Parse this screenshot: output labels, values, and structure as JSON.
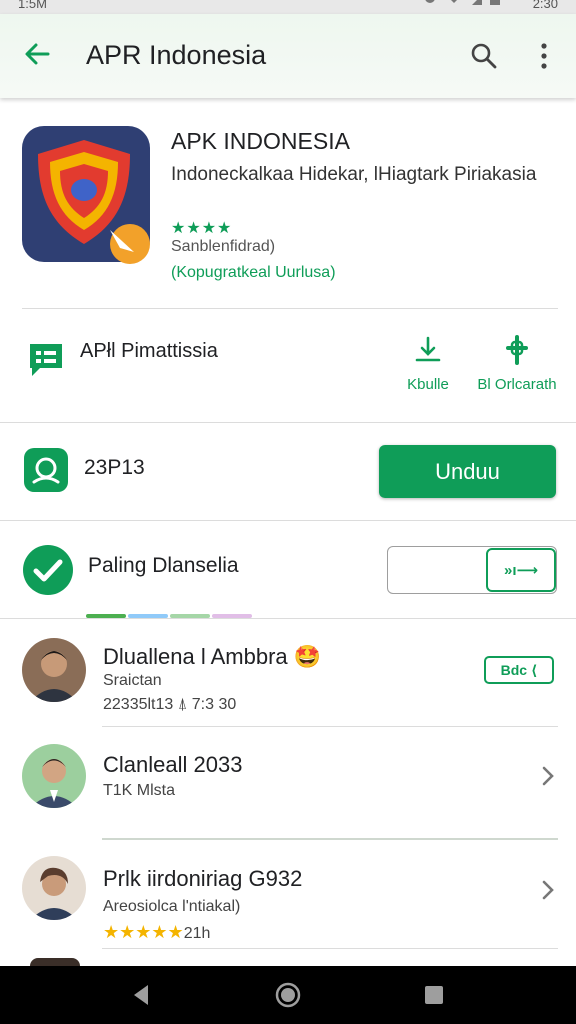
{
  "status_bar": {
    "time_left": "1:5M",
    "time_right": "2:30",
    "icons": [
      "sim-icon",
      "data-icon",
      "signal-icon",
      "wifi-icon",
      "battery-icon"
    ]
  },
  "app_bar": {
    "title": "APR Indonesia",
    "icons": [
      "back-arrow-icon",
      "search-icon",
      "more-vert-icon"
    ]
  },
  "app_header": {
    "name": "APK INDONESIA",
    "description": "Indoneckalkaa Hidekar, lHiagtark Piriakasia",
    "rating_stars": "★★★★",
    "subtitle": "Sanblenfidrad)",
    "link": "(Kopugratkeal Uurlusa)"
  },
  "feature": {
    "label": "APłl Pimattissia",
    "actions": [
      {
        "label": "Kbulle",
        "icon": "download-tray-icon"
      },
      {
        "label": "Bl Orlcarath",
        "icon": "plus-pin-icon"
      }
    ]
  },
  "download": {
    "label": "23P13",
    "button": "Unduu"
  },
  "popular": {
    "label": "Paling Dlanselia",
    "field_value": "",
    "button_label": "»ı⟶",
    "strip_colors": [
      "#4caf50",
      "#90caf9",
      "#a5d6a7",
      "#e1bee7"
    ]
  },
  "reviews": [
    {
      "name": "Dluallena l Ambbra",
      "emoji": "🤩",
      "sub": "Sraictan",
      "meta": "22335lt13 ⍋ 7:3 30",
      "badge": "Bdc ⟨",
      "action": "badge"
    },
    {
      "name": "Clanleall 2033",
      "sub": "T1K Mlsta",
      "meta": "",
      "action": "chevron"
    },
    {
      "name": "Prlk iirdoniriag G932",
      "sub": "Areosiolca l'ntiakal)",
      "stars": "★★★★★",
      "meta": "21h",
      "action": "chevron"
    }
  ],
  "colors": {
    "accent": "#0f9d58",
    "star_gold": "#f4b400",
    "nav_bg": "#000000"
  },
  "nav_bar": {
    "icons": [
      "nav-back-icon",
      "nav-home-icon",
      "nav-recents-icon"
    ]
  }
}
